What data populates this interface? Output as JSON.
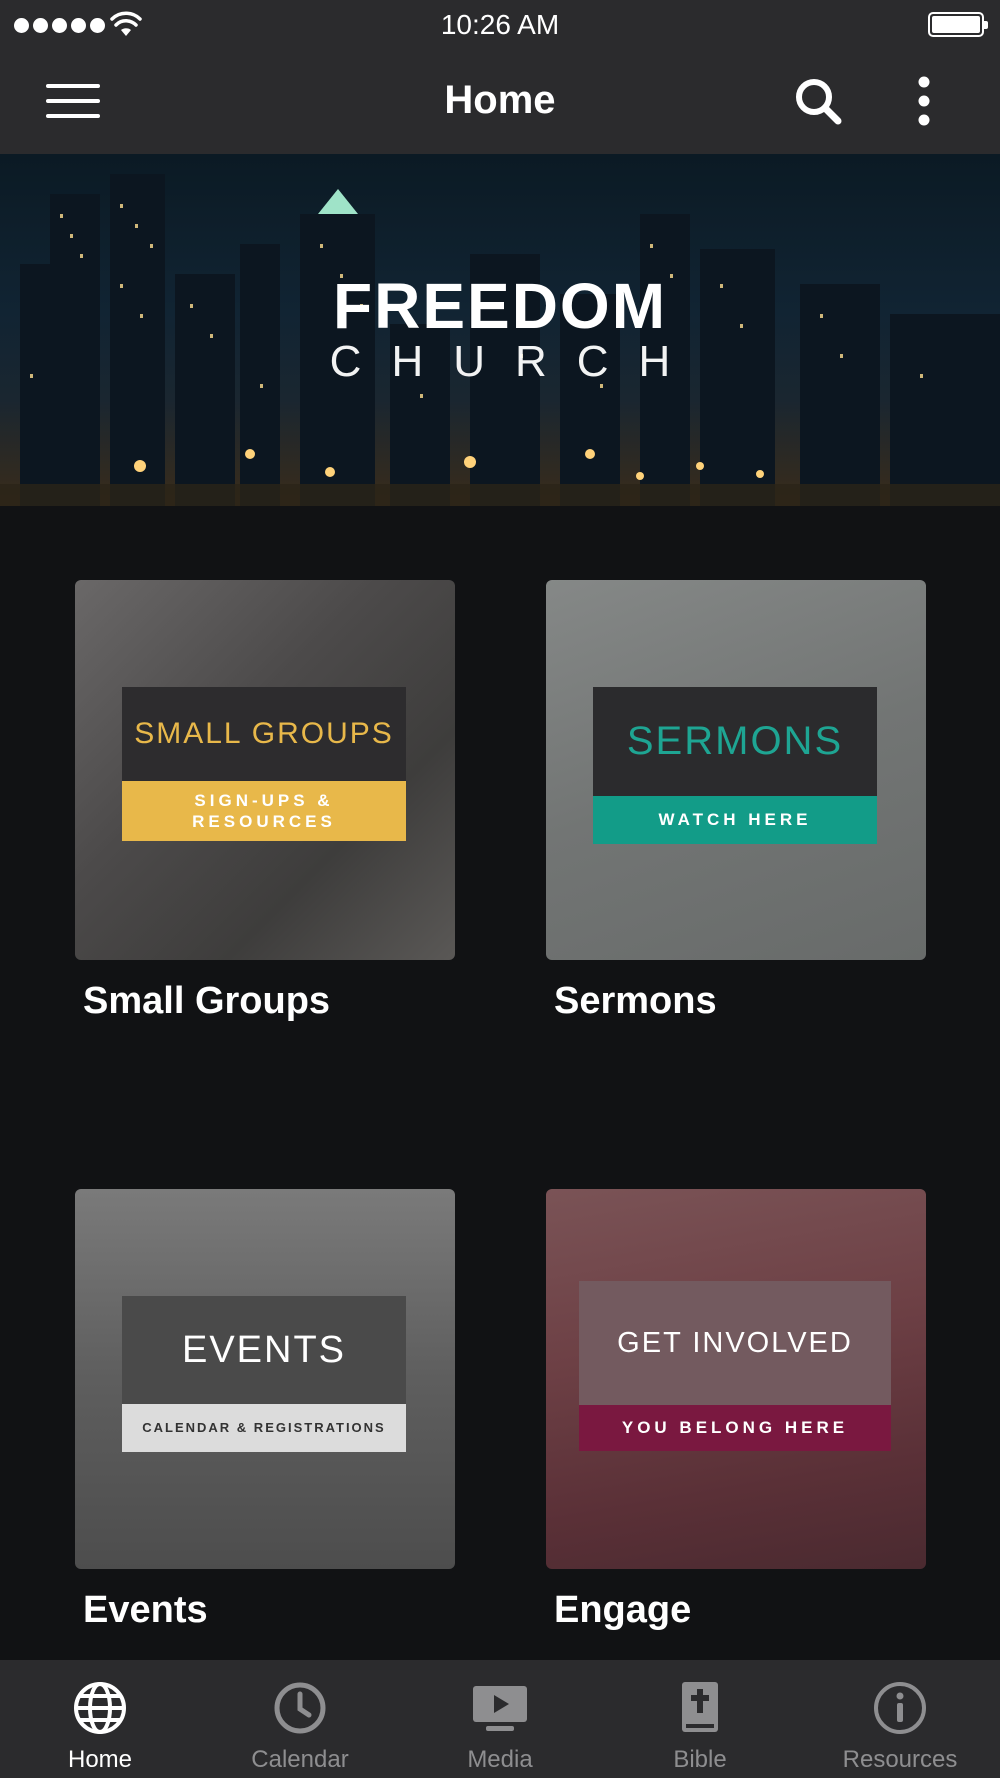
{
  "status_bar": {
    "time": "10:26 AM",
    "signal_bars": 5,
    "wifi": true,
    "battery_level": 1.0
  },
  "nav": {
    "title": "Home",
    "menu_icon": "hamburger-icon",
    "search_icon": "search-icon",
    "more_icon": "more-vertical-icon"
  },
  "banner": {
    "title": "FREEDOM",
    "subtitle": "CHURCH"
  },
  "tiles": [
    {
      "caption": "Small Groups",
      "overlay_title": "SMALL GROUPS",
      "overlay_sub": "SIGN-UPS & RESOURCES",
      "title_color": "#e8b84a",
      "title_bg": "#2d2c2e",
      "sub_bg": "#e8b84a",
      "sub_color": "#ffffff"
    },
    {
      "caption": "Sermons",
      "overlay_title": "SERMONS",
      "overlay_sub": "WATCH HERE",
      "title_color": "#1ea593",
      "title_bg": "#2b2b2d",
      "sub_bg": "#129c88",
      "sub_color": "#ffffff"
    },
    {
      "caption": "Events",
      "overlay_title": "EVENTS",
      "overlay_sub": "CALENDAR & REGISTRATIONS",
      "title_color": "#ffffff",
      "title_bg": "#4a4a4a",
      "sub_bg": "#dcdcdc",
      "sub_color": "#333333"
    },
    {
      "caption": "Engage",
      "overlay_title": "GET INVOLVED",
      "overlay_sub": "YOU BELONG HERE",
      "title_color": "#ffffff",
      "title_bg": "#735a5f",
      "sub_bg": "#7a1840",
      "sub_color": "#ffffff"
    }
  ],
  "tab_bar": {
    "items": [
      {
        "label": "Home",
        "icon": "globe-icon",
        "active": true
      },
      {
        "label": "Calendar",
        "icon": "clock-icon",
        "active": false
      },
      {
        "label": "Media",
        "icon": "play-screen-icon",
        "active": false
      },
      {
        "label": "Bible",
        "icon": "bible-icon",
        "active": false
      },
      {
        "label": "Resources",
        "icon": "info-icon",
        "active": false
      }
    ]
  },
  "colors": {
    "background": "#111214",
    "bars": "#2b2b2d",
    "tab_inactive": "#8e8e90",
    "tab_active": "#ffffff"
  }
}
